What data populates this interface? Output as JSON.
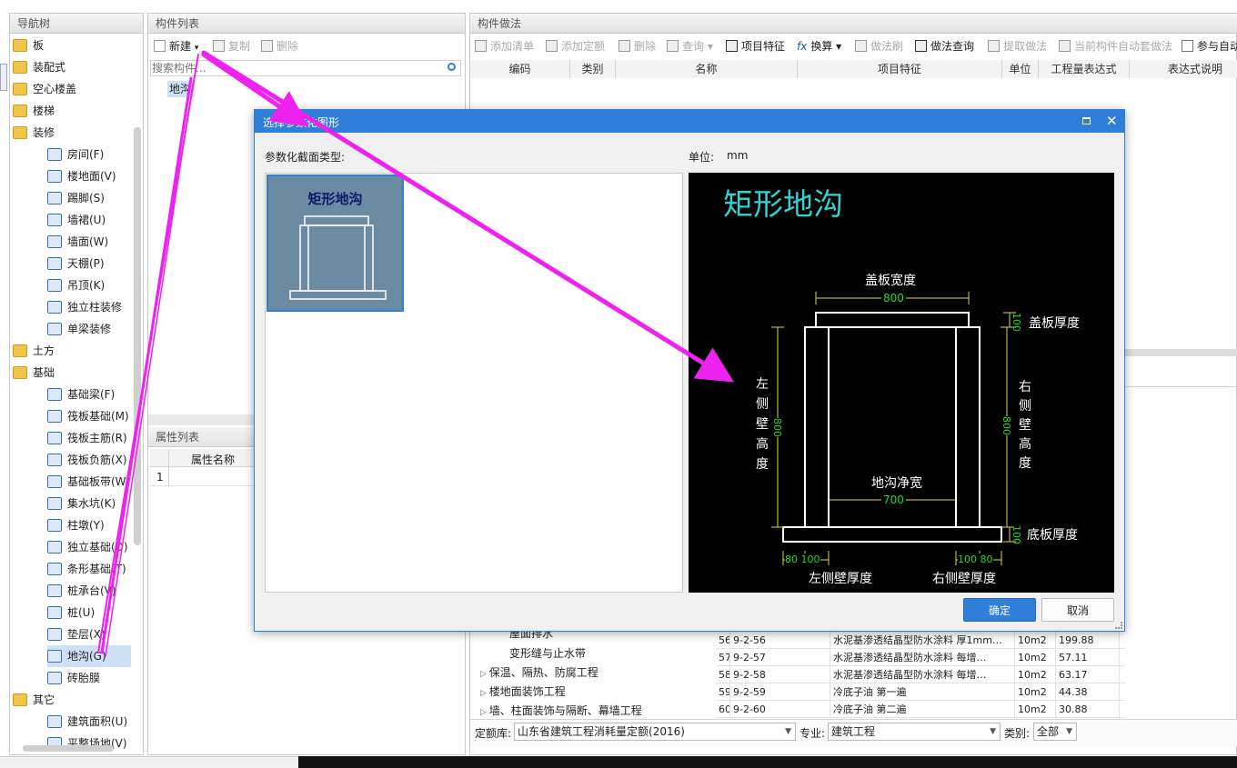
{
  "nav": {
    "title": "导航树",
    "items": [
      {
        "label": "板",
        "kind": "folder"
      },
      {
        "label": "装配式",
        "kind": "folder"
      },
      {
        "label": "空心楼盖",
        "kind": "folder"
      },
      {
        "label": "楼梯",
        "kind": "folder"
      },
      {
        "label": "装修",
        "kind": "folder-open"
      },
      {
        "label": "房间(F)",
        "kind": "sub"
      },
      {
        "label": "楼地面(V)",
        "kind": "sub"
      },
      {
        "label": "踢脚(S)",
        "kind": "sub"
      },
      {
        "label": "墙裙(U)",
        "kind": "sub"
      },
      {
        "label": "墙面(W)",
        "kind": "sub"
      },
      {
        "label": "天棚(P)",
        "kind": "sub"
      },
      {
        "label": "吊顶(K)",
        "kind": "sub"
      },
      {
        "label": "独立柱装修",
        "kind": "sub"
      },
      {
        "label": "单梁装修",
        "kind": "sub"
      },
      {
        "label": "土方",
        "kind": "folder"
      },
      {
        "label": "基础",
        "kind": "folder-open"
      },
      {
        "label": "基础梁(F)",
        "kind": "sub"
      },
      {
        "label": "筏板基础(M)",
        "kind": "sub"
      },
      {
        "label": "筏板主筋(R)",
        "kind": "sub"
      },
      {
        "label": "筏板负筋(X)",
        "kind": "sub"
      },
      {
        "label": "基础板带(W)",
        "kind": "sub"
      },
      {
        "label": "集水坑(K)",
        "kind": "sub"
      },
      {
        "label": "柱墩(Y)",
        "kind": "sub"
      },
      {
        "label": "独立基础(D)",
        "kind": "sub"
      },
      {
        "label": "条形基础(T)",
        "kind": "sub"
      },
      {
        "label": "桩承台(V)",
        "kind": "sub"
      },
      {
        "label": "桩(U)",
        "kind": "sub"
      },
      {
        "label": "垫层(X)",
        "kind": "sub"
      },
      {
        "label": "地沟(G)",
        "kind": "sub-selected"
      },
      {
        "label": "砖胎膜",
        "kind": "sub"
      },
      {
        "label": "其它",
        "kind": "folder-open"
      },
      {
        "label": "建筑面积(U)",
        "kind": "sub"
      },
      {
        "label": "平整场地(V)",
        "kind": "sub"
      }
    ]
  },
  "component_list": {
    "title": "构件列表",
    "new_label": "新建",
    "copy_label": "复制",
    "delete_label": "删除",
    "search_placeholder": "搜索构件...",
    "item": "地沟"
  },
  "props": {
    "title": "属性列表",
    "col_name": "属性名称",
    "row1": "1"
  },
  "method": {
    "title": "构件做法",
    "toolbar": {
      "add_list": "添加清单",
      "add_quota": "添加定额",
      "delete": "删除",
      "query": "查询",
      "item_feature": "项目特征",
      "convert": "换算",
      "brush": "做法刷",
      "method_query": "做法查询",
      "extract": "提取做法",
      "auto": "当前构件自动套做法",
      "participate": "参与自动"
    },
    "columns": [
      "编码",
      "类别",
      "名称",
      "项目特征",
      "单位",
      "工程量表达式",
      "表达式说明"
    ]
  },
  "quota_tree": [
    "屋面排水",
    "变形缝与止水带",
    "保温、隔热、防腐工程",
    "楼地面装饰工程",
    "墙、柱面装饰与隔断、幕墙工程"
  ],
  "quota_rows": [
    {
      "no": "56",
      "code": "9-2-56",
      "name": "水泥基渗透结晶型防水涂料 厚1mm…",
      "unit": "10m2",
      "price": "199.88"
    },
    {
      "no": "57",
      "code": "9-2-57",
      "name": "水泥基渗透结晶型防水涂料 每增…",
      "unit": "10m2",
      "price": "57.11"
    },
    {
      "no": "58",
      "code": "9-2-58",
      "name": "水泥基渗透结晶型防水涂料 每增…",
      "unit": "10m2",
      "price": "63.17"
    },
    {
      "no": "59",
      "code": "9-2-59",
      "name": "冷底子油 第一遍",
      "unit": "10m2",
      "price": "44.38"
    },
    {
      "no": "60",
      "code": "9-2-60",
      "name": "冷底子油 第二遍",
      "unit": "10m2",
      "price": "30.88"
    }
  ],
  "bottom": {
    "quota_lib_label": "定额库:",
    "quota_lib_value": "山东省建筑工程消耗量定额(2016)",
    "major_label": "专业:",
    "major_value": "建筑工程",
    "category_label": "类别:",
    "category_value": "全部"
  },
  "dialog": {
    "title": "选择参数化图形",
    "section_label": "参数化截面类型:",
    "unit_label": "单位:",
    "unit_value": "mm",
    "thumb_label": "矩形地沟",
    "preview": {
      "title": "矩形地沟",
      "cover_width_label": "盖板宽度",
      "cover_width_value": "800",
      "cover_thick_label": "盖板厚度",
      "cover_thick_value": "100",
      "left_wall_label": "左侧壁高度",
      "left_wall_value": "800",
      "right_wall_label": "右侧壁高度",
      "right_wall_value": "800",
      "net_width_label": "地沟净宽",
      "net_width_value": "700",
      "base_thick_label": "底板厚度",
      "base_thick_value": "100",
      "left_thick_label": "左侧壁厚度",
      "right_thick_label": "右侧壁厚度",
      "left_dims": "80 100",
      "right_dims": "100 80"
    },
    "ok_label": "确定",
    "cancel_label": "取消"
  },
  "colors": {
    "dialog_header": "#2f7fd8",
    "arrow": "#ee22ee",
    "thumb_bg": "#6b8ba3",
    "cad_cyan": "#2fd4d4",
    "cad_green": "#22dd22"
  }
}
